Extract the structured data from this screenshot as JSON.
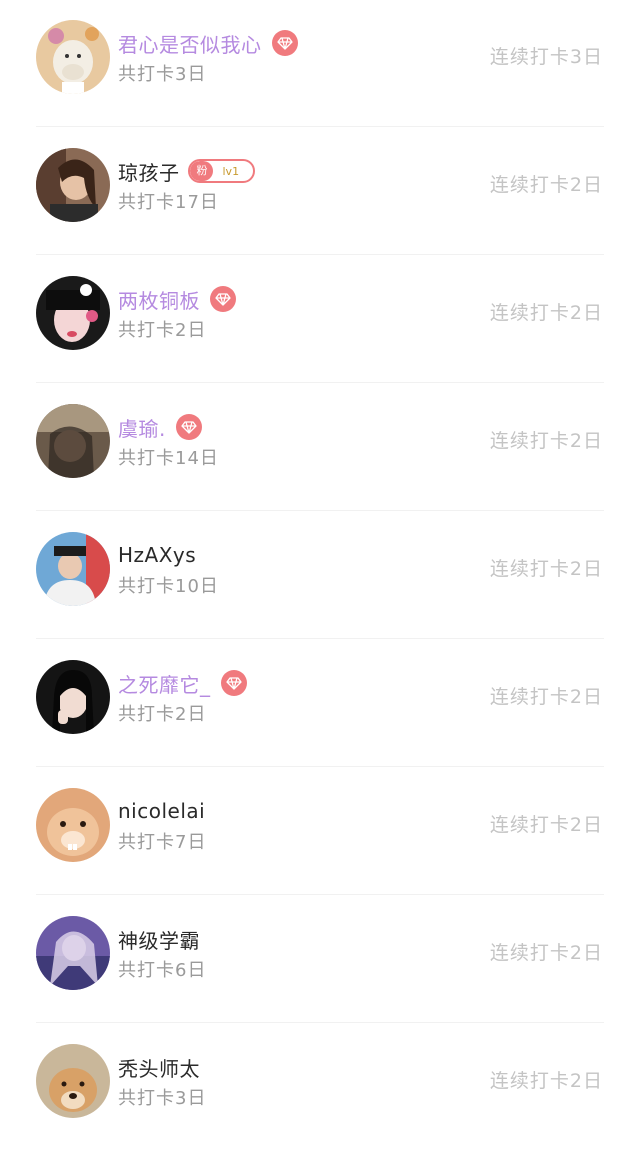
{
  "checkin_list": {
    "items": [
      {
        "name": "君心是否似我心",
        "vip": true,
        "fan_badge": null,
        "total": "共打卡3日",
        "streak": "连续打卡3日"
      },
      {
        "name": "琼孩子",
        "vip": false,
        "fan_badge": {
          "label": "粉",
          "level": "lv1"
        },
        "total": "共打卡17日",
        "streak": "连续打卡2日"
      },
      {
        "name": "两枚铜板",
        "vip": true,
        "fan_badge": null,
        "total": "共打卡2日",
        "streak": "连续打卡2日"
      },
      {
        "name": "虞瑜.",
        "vip": true,
        "fan_badge": null,
        "total": "共打卡14日",
        "streak": "连续打卡2日"
      },
      {
        "name": "HzAXys",
        "vip": false,
        "fan_badge": null,
        "total": "共打卡10日",
        "streak": "连续打卡2日"
      },
      {
        "name": "之死靡它_",
        "vip": true,
        "fan_badge": null,
        "total": "共打卡2日",
        "streak": "连续打卡2日"
      },
      {
        "name": "nicolelai",
        "vip": false,
        "fan_badge": null,
        "total": "共打卡7日",
        "streak": "连续打卡2日"
      },
      {
        "name": "神级学霸",
        "vip": false,
        "fan_badge": null,
        "total": "共打卡6日",
        "streak": "连续打卡2日"
      },
      {
        "name": "秃头师太",
        "vip": false,
        "fan_badge": null,
        "total": "共打卡3日",
        "streak": "连续打卡2日"
      }
    ]
  },
  "icons": {
    "vip_badge": "diamond-icon"
  },
  "colors": {
    "vip_name": "#b58ae0",
    "normal_name": "#2a2a2a",
    "badge_red": "#f07a7e",
    "secondary_text": "#9a9a9a",
    "streak_text": "#c4c4c4"
  }
}
